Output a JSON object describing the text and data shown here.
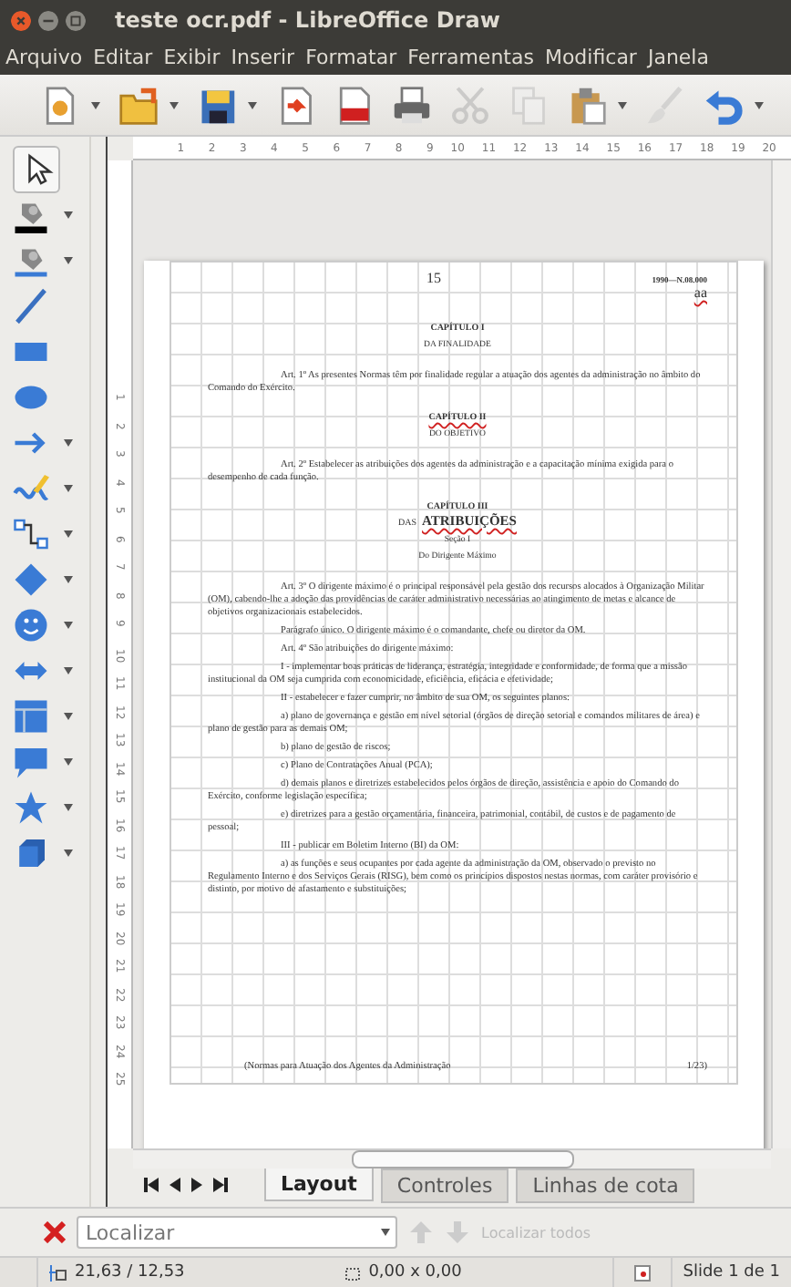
{
  "window": {
    "title": "teste ocr.pdf - LibreOffice Draw"
  },
  "menu": [
    "Arquivo",
    "Editar",
    "Exibir",
    "Inserir",
    "Formatar",
    "Ferramentas",
    "Modificar",
    "Janela"
  ],
  "toolbar": [
    {
      "kind": "new",
      "dropdown": true,
      "disabled": false
    },
    {
      "kind": "open",
      "dropdown": true,
      "disabled": false
    },
    {
      "kind": "save",
      "dropdown": true,
      "disabled": false
    },
    {
      "kind": "export",
      "dropdown": false,
      "disabled": false
    },
    {
      "kind": "pdf",
      "dropdown": false,
      "disabled": false
    },
    {
      "kind": "print",
      "dropdown": false,
      "disabled": false
    },
    {
      "kind": "cut",
      "dropdown": false,
      "disabled": true
    },
    {
      "kind": "copy",
      "dropdown": false,
      "disabled": true
    },
    {
      "kind": "paste",
      "dropdown": true,
      "disabled": false
    },
    {
      "kind": "clone",
      "dropdown": false,
      "disabled": true
    },
    {
      "kind": "undo",
      "dropdown": true,
      "disabled": false
    }
  ],
  "ruler_h": [
    "1",
    "2",
    "3",
    "4",
    "5",
    "6",
    "7",
    "8",
    "9",
    "10",
    "11",
    "12",
    "13",
    "14",
    "15",
    "16",
    "17",
    "18",
    "19",
    "20"
  ],
  "ruler_v": [
    "1",
    "2",
    "3",
    "4",
    "5",
    "6",
    "7",
    "8",
    "9",
    "10",
    "11",
    "12",
    "13",
    "14",
    "15",
    "16",
    "17",
    "18",
    "19",
    "20",
    "21",
    "22",
    "23",
    "24",
    "25"
  ],
  "side_tools": [
    {
      "kind": "select",
      "dropdown": false,
      "selected": true
    },
    {
      "kind": "line_color",
      "dropdown": true,
      "selected": false
    },
    {
      "kind": "fill_color",
      "dropdown": true,
      "selected": false
    },
    {
      "kind": "line",
      "dropdown": false,
      "selected": false
    },
    {
      "kind": "rect",
      "dropdown": false,
      "selected": false
    },
    {
      "kind": "ellipse",
      "dropdown": false,
      "selected": false
    },
    {
      "kind": "arrow",
      "dropdown": true,
      "selected": false
    },
    {
      "kind": "curve",
      "dropdown": true,
      "selected": false
    },
    {
      "kind": "connector",
      "dropdown": true,
      "selected": false
    },
    {
      "kind": "diamond",
      "dropdown": true,
      "selected": false
    },
    {
      "kind": "smiley",
      "dropdown": true,
      "selected": false
    },
    {
      "kind": "double_arrow",
      "dropdown": true,
      "selected": false
    },
    {
      "kind": "flowchart",
      "dropdown": true,
      "selected": false
    },
    {
      "kind": "callout",
      "dropdown": true,
      "selected": false
    },
    {
      "kind": "star",
      "dropdown": true,
      "selected": false
    },
    {
      "kind": "cube",
      "dropdown": true,
      "selected": false
    }
  ],
  "page": {
    "page_number": "15",
    "header_right": "1990—N.08.000",
    "lines": [
      {
        "kind": "right",
        "text": "aa",
        "underlined": true
      },
      {
        "kind": "heading",
        "text": "CAPÍTULO I",
        "underlined": false
      },
      {
        "kind": "subheading",
        "text": "DA FINALIDADE",
        "underlined": false
      },
      {
        "kind": "article",
        "text": "Art. 1º As presentes Normas têm por finalidade regular a atuação dos agentes da administração no âmbito do Comando do Exército.",
        "underlined": false
      },
      {
        "kind": "heading",
        "text": "CAPÍTULO II",
        "underlined": true
      },
      {
        "kind": "subheading",
        "text": "DO OBJETIVO",
        "underlined": false
      },
      {
        "kind": "article",
        "text": "Art. 2º Estabelecer as atribuições dos agentes da administração e a capacitação mínima exigida para o desempenho de cada função.",
        "underlined": false
      },
      {
        "kind": "heading",
        "text": "CAPÍTULO III",
        "underlined": false
      },
      {
        "kind": "title",
        "parts": [
          {
            "text": "DAS",
            "underlined": false
          },
          {
            "text": "ATRIBUIÇÕES",
            "underlined": true
          }
        ]
      },
      {
        "kind": "subheading",
        "text": "Seção I",
        "underlined": false
      },
      {
        "kind": "subheading",
        "text": "Do Dirigente Máximo",
        "underlined": false
      },
      {
        "kind": "article",
        "text": "Art. 3º O dirigente máximo é o principal responsável pela gestão dos recursos alocados à Organização Militar (OM), cabendo-lhe a adoção das providências de caráter administrativo necessárias ao atingimento de metas e alcance de objetivos organizacionais estabelecidos.",
        "underlined": false
      },
      {
        "kind": "para",
        "text": "Parágrafo único. O dirigente máximo é o comandante, chefe ou diretor da OM.",
        "underlined": false
      },
      {
        "kind": "para",
        "text": "Art. 4º São atribuições do dirigente máximo:",
        "underlined": false
      },
      {
        "kind": "para",
        "text": "I - implementar boas práticas de liderança, estratégia, integridade e conformidade, de forma que a missão institucional da OM seja cumprida com economicidade, eficiência, eficácia e efetividade;",
        "underlined": false
      },
      {
        "kind": "para",
        "text": "II - estabelecer e fazer cumprir, no âmbito de sua OM, os seguintes planos:",
        "underlined": false
      },
      {
        "kind": "para",
        "text": "a) plano de governança e gestão em nível setorial (órgãos de direção setorial e comandos militares de área) e plano de gestão para as demais OM;",
        "underlined": false
      },
      {
        "kind": "para",
        "text": "b) plano de gestão de riscos;",
        "underlined": false
      },
      {
        "kind": "para",
        "text": "c) Plano de Contratações Anual (PCA);",
        "underlined": false
      },
      {
        "kind": "para",
        "text": "d) demais planos e diretrizes estabelecidos pelos órgãos de direção, assistência e apoio do Comando do Exército, conforme legislação específica;",
        "underlined": false
      },
      {
        "kind": "para",
        "text": "e) diretrizes para a gestão orçamentária, financeira, patrimonial, contábil, de custos e de pagamento de pessoal;",
        "underlined": false
      },
      {
        "kind": "para",
        "text": "III - publicar em Boletim Interno (BI) da OM:",
        "underlined": false
      },
      {
        "kind": "para",
        "text": "a) as funções e seus ocupantes por cada agente da administração da OM, observado o previsto no Regulamento Interno e dos Serviços Gerais (RISG), bem como os princípios dispostos nestas normas, com caráter provisório e distinto, por motivo de afastamento e substituições;",
        "underlined": false
      }
    ],
    "footer_left": "(Normas para Atuação dos Agentes da Administração",
    "footer_right": "1/23)"
  },
  "tabs": [
    {
      "label": "Layout",
      "selected": true
    },
    {
      "label": "Controles",
      "selected": false
    },
    {
      "label": "Linhas de cota",
      "selected": false
    }
  ],
  "find": {
    "placeholder": "Localizar",
    "find_all": "Localizar todos",
    "find_all_disabled": true
  },
  "status": {
    "position": "21,63 / 12,53",
    "size": "0,00 x 0,00",
    "slide": "Slide 1 de 1"
  }
}
